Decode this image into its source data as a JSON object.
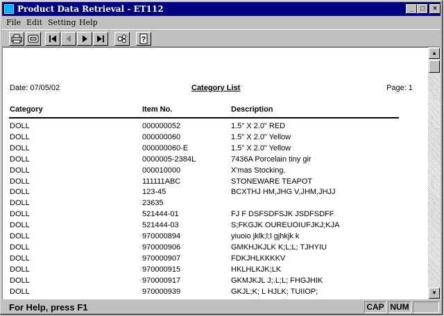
{
  "window": {
    "title": "Product Data Retrieval - ET112"
  },
  "title_buttons": {
    "minimize": "_",
    "maximize": "□",
    "close": "×"
  },
  "menu": [
    "File",
    "Edit",
    "Setting",
    "Help"
  ],
  "toolbar": {
    "icons": [
      "print-icon",
      "print-preview-icon",
      "first-record-icon",
      "prev-record-icon",
      "next-record-icon",
      "last-record-icon",
      "settings-icon",
      "help-icon"
    ]
  },
  "report": {
    "date": "Date: 07/05/02",
    "title": "Category List",
    "page": "Page: 1",
    "columns": [
      "Category",
      "Item No.",
      "Description"
    ],
    "rows": [
      [
        "DOLL",
        "000000052",
        "1.5\" X 2.0\" RED"
      ],
      [
        "DOLL",
        "000000060",
        "1.5\" X 2.0\" Yellow"
      ],
      [
        "DOLL",
        "000000060-E",
        "1.5\" X 2.0\" Yellow"
      ],
      [
        "DOLL",
        "0000005-2384L",
        "7436A Porcelain tiny gir"
      ],
      [
        "DOLL",
        "000010000",
        "X'mas Stocking."
      ],
      [
        "DOLL",
        "111111ABC",
        "STONEWARE TEAPOT"
      ],
      [
        "DOLL",
        "123-45",
        "BCXTHJ HM,JHG V,JHM,JHJJ"
      ],
      [
        "DOLL",
        "23635",
        ""
      ],
      [
        "DOLL",
        "521444-01",
        "FJ F DSFSDFSJK JSDFSDFF"
      ],
      [
        "DOLL",
        "521444-03",
        "S;FKGJK OUREUOIUFJKJ;KJA"
      ],
      [
        "DOLL",
        "970000894",
        "yiuoio jklk;l;l gjhkjk k"
      ],
      [
        "DOLL",
        "970000906",
        "GMKHJKJLK  K;L;L; TJHYIU"
      ],
      [
        "DOLL",
        "970000907",
        "FDKJHLKKKKV"
      ],
      [
        "DOLL",
        "970000915",
        "HKLHLKJK;LK"
      ],
      [
        "DOLL",
        "970000917",
        "GKMJKJL J;.L;L; FHGJHIK"
      ],
      [
        "DOLL",
        "970000939",
        "GKJL;K; L HJLK; TUIIOP;"
      ]
    ]
  },
  "status": {
    "text": "For Help, press F1",
    "cap": "CAP",
    "num": "NUM"
  },
  "colors": {
    "titlebar": "#000080",
    "face": "#c0c0c0",
    "client": "#ffffff",
    "app_icon": "#00b4ff"
  }
}
